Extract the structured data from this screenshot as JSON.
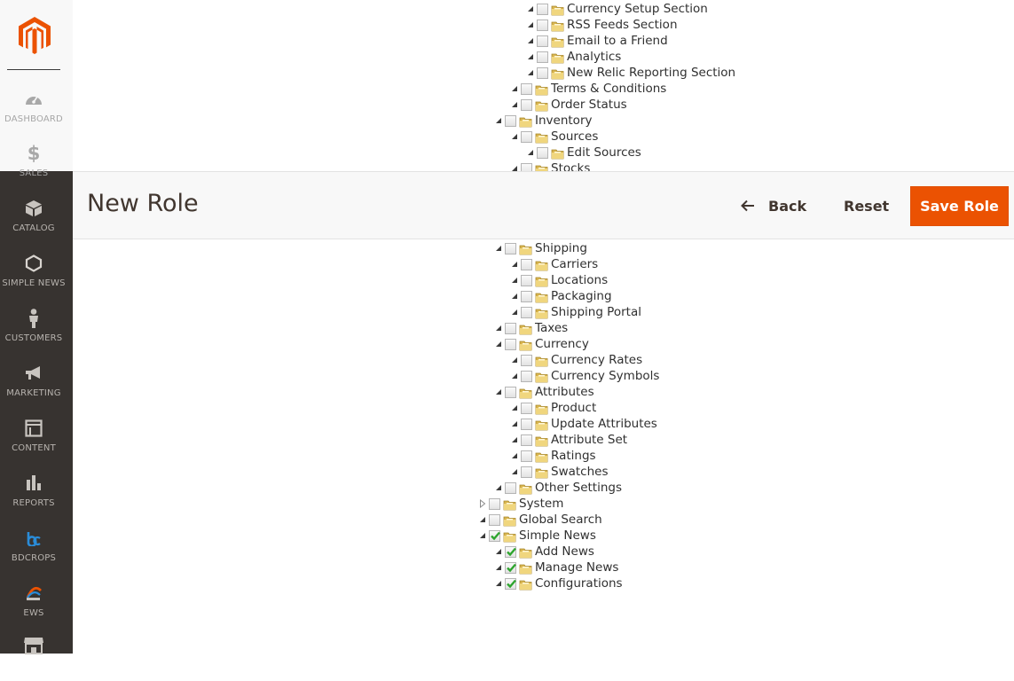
{
  "header": {
    "title": "New Role",
    "back_label": "Back",
    "reset_label": "Reset",
    "save_label": "Save Role",
    "accent_color": "#eb5202"
  },
  "sidebar": {
    "items": [
      {
        "label": "DASHBOARD",
        "icon": "dashboard-gauge-icon"
      },
      {
        "label": "SALES",
        "icon": "dollar-icon"
      },
      {
        "label": "CATALOG",
        "icon": "box-icon"
      },
      {
        "label": "SIMPLE NEWS",
        "icon": "hexagon-icon"
      },
      {
        "label": "CUSTOMERS",
        "icon": "person-icon"
      },
      {
        "label": "MARKETING",
        "icon": "megaphone-icon"
      },
      {
        "label": "CONTENT",
        "icon": "layout-icon"
      },
      {
        "label": "REPORTS",
        "icon": "bar-chart-icon"
      },
      {
        "label": "BDCROPS",
        "icon": "bdcrops-logo-icon"
      },
      {
        "label": "EWS",
        "icon": "ews-logo-icon"
      },
      {
        "label": "",
        "icon": "store-icon"
      }
    ]
  },
  "tree": {
    "nodes": [
      {
        "label": "Currency Setup Section",
        "level": 3,
        "expanded": true,
        "checked": false
      },
      {
        "label": "RSS Feeds Section",
        "level": 3,
        "expanded": true,
        "checked": false
      },
      {
        "label": "Email to a Friend",
        "level": 3,
        "expanded": true,
        "checked": false
      },
      {
        "label": "Analytics",
        "level": 3,
        "expanded": true,
        "checked": false
      },
      {
        "label": "New Relic Reporting Section",
        "level": 3,
        "expanded": true,
        "checked": false
      },
      {
        "label": "Terms & Conditions",
        "level": 2,
        "expanded": true,
        "checked": false
      },
      {
        "label": "Order Status",
        "level": 2,
        "expanded": true,
        "checked": false
      },
      {
        "label": "Inventory",
        "level": 1,
        "expanded": true,
        "checked": false
      },
      {
        "label": "Sources",
        "level": 2,
        "expanded": true,
        "checked": false
      },
      {
        "label": "Edit Sources",
        "level": 3,
        "expanded": true,
        "checked": false
      },
      {
        "label": "Stocks",
        "level": 2,
        "expanded": true,
        "checked": false
      },
      {
        "label": "Shipping",
        "level": 1,
        "expanded": true,
        "checked": false
      },
      {
        "label": "Carriers",
        "level": 2,
        "expanded": true,
        "checked": false
      },
      {
        "label": "Locations",
        "level": 2,
        "expanded": true,
        "checked": false
      },
      {
        "label": "Packaging",
        "level": 2,
        "expanded": true,
        "checked": false
      },
      {
        "label": "Shipping Portal",
        "level": 2,
        "expanded": true,
        "checked": false
      },
      {
        "label": "Taxes",
        "level": 1,
        "expanded": true,
        "checked": false
      },
      {
        "label": "Currency",
        "level": 1,
        "expanded": true,
        "checked": false
      },
      {
        "label": "Currency Rates",
        "level": 2,
        "expanded": true,
        "checked": false
      },
      {
        "label": "Currency Symbols",
        "level": 2,
        "expanded": true,
        "checked": false
      },
      {
        "label": "Attributes",
        "level": 1,
        "expanded": true,
        "checked": false
      },
      {
        "label": "Product",
        "level": 2,
        "expanded": true,
        "checked": false
      },
      {
        "label": "Update Attributes",
        "level": 2,
        "expanded": true,
        "checked": false
      },
      {
        "label": "Attribute Set",
        "level": 2,
        "expanded": true,
        "checked": false
      },
      {
        "label": "Ratings",
        "level": 2,
        "expanded": true,
        "checked": false
      },
      {
        "label": "Swatches",
        "level": 2,
        "expanded": true,
        "checked": false
      },
      {
        "label": "Other Settings",
        "level": 1,
        "expanded": true,
        "checked": false
      },
      {
        "label": "System",
        "level": 0,
        "expanded": false,
        "checked": false
      },
      {
        "label": "Global Search",
        "level": 0,
        "expanded": true,
        "checked": false
      },
      {
        "label": "Simple News",
        "level": 0,
        "expanded": true,
        "checked": true
      },
      {
        "label": "Add News",
        "level": 1,
        "expanded": true,
        "checked": true
      },
      {
        "label": "Manage News",
        "level": 1,
        "expanded": true,
        "checked": true
      },
      {
        "label": "Configurations",
        "level": 1,
        "expanded": true,
        "checked": true
      }
    ]
  }
}
